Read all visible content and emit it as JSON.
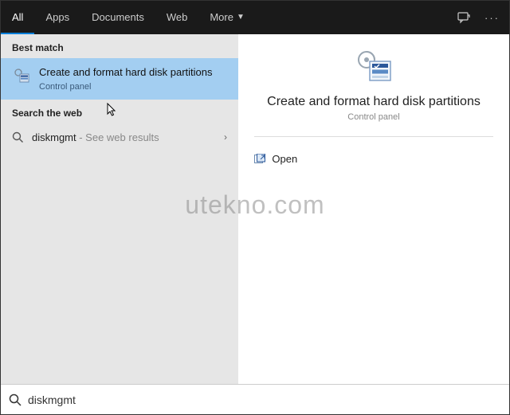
{
  "topbar": {
    "tabs": [
      {
        "label": "All",
        "active": true
      },
      {
        "label": "Apps",
        "active": false
      },
      {
        "label": "Documents",
        "active": false
      },
      {
        "label": "Web",
        "active": false
      },
      {
        "label": "More",
        "active": false,
        "dropdown": true
      }
    ]
  },
  "left": {
    "best_match_label": "Best match",
    "best_match": {
      "title": "Create and format hard disk partitions",
      "subtitle": "Control panel"
    },
    "search_web_label": "Search the web",
    "web_result": {
      "query": "diskmgmt",
      "suffix": " - See web results"
    }
  },
  "right": {
    "title": "Create and format hard disk partitions",
    "subtitle": "Control panel",
    "open_label": "Open"
  },
  "searchbar": {
    "value": "diskmgmt"
  },
  "watermark": "utekno.com"
}
